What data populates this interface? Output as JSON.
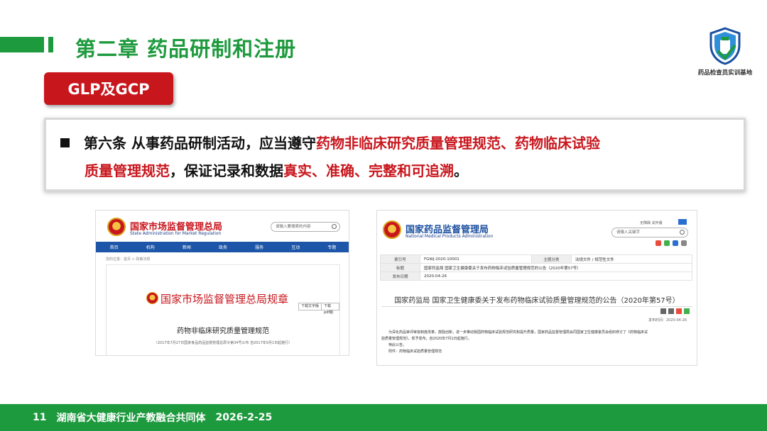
{
  "header": {
    "title": "第二章  药品研制和注册"
  },
  "logo": {
    "caption": "药品检查员实训基地"
  },
  "section": {
    "tag": "GLP及GCP"
  },
  "clause": {
    "line1_a": "第六条    从事药品研制活动，应当遵守",
    "line1_b": "药物非临床研究质量管理规范、药物临床试验",
    "line2_a": "质量管理规范",
    "line2_b": "，保证记录和数据",
    "line2_c": "真实、准确、完整和可追溯",
    "line2_d": "。"
  },
  "left_shot": {
    "org_cn": "国家市场监督管理总局",
    "org_en": "State Administration for Market Regulation",
    "search_placeholder": "请输入要搜索的内容",
    "nav": [
      "首页",
      "机构",
      "新闻",
      "政务",
      "服务",
      "互动",
      "专题"
    ],
    "breadcrumb": "您的位置：首页 > 政策法规",
    "reg_header": "国家市场监督管理总局规章",
    "btn_text": "下载文字版",
    "btn_pdf": "下载pdf版",
    "doc_title": "药物非临床研究质量管理规范",
    "doc_sub": "（2017年7月27日国家食品药品监督管理总局令第34号公布  自2017年9月1日起施行）"
  },
  "right_shot": {
    "org_cn": "国家药品监督管理局",
    "org_en": "National Medical Products Administration",
    "util_links": "无障碍  关怀版",
    "search_placeholder": "请输入关键字",
    "meta": {
      "r1_label": "索引号",
      "r1_value": "FGWJ-2020-10001",
      "r1_label2": "主题分类",
      "r1_value2": "法规文件 / 规范性文件",
      "r2_label": "标题",
      "r2_value": "国家药监局 国家卫生健康委关于发布药物临床试验质量管理规范的公告（2020年第57号）",
      "r3_label": "发布日期",
      "r3_value": "2020-04-26"
    },
    "ann_title": "国家药监局 国家卫生健康委关于发布药物临床试验质量管理规范的公告（2020年第57号）",
    "ann_date": "发布时间：2020-04-26",
    "body": [
      "为深化药品审评审批制度改革，鼓励创新，进一步推动我国药物临床试验规范研究和提升质量，国家药品监督管理局会同国家卫生健康委员会组织修订了《药物临床试",
      "验质量管理规范》，现予发布，自2020年7月1日起施行。",
      "特此公告。",
      "附件：药物临床试验质量管理规范"
    ]
  },
  "footer": {
    "page": "11",
    "org": "湖南省大健康行业产教融合共同体",
    "date": "2026-2-25"
  },
  "colors": {
    "green": "#1e9a3e",
    "red": "#c8161d",
    "blue": "#1d56a8"
  }
}
